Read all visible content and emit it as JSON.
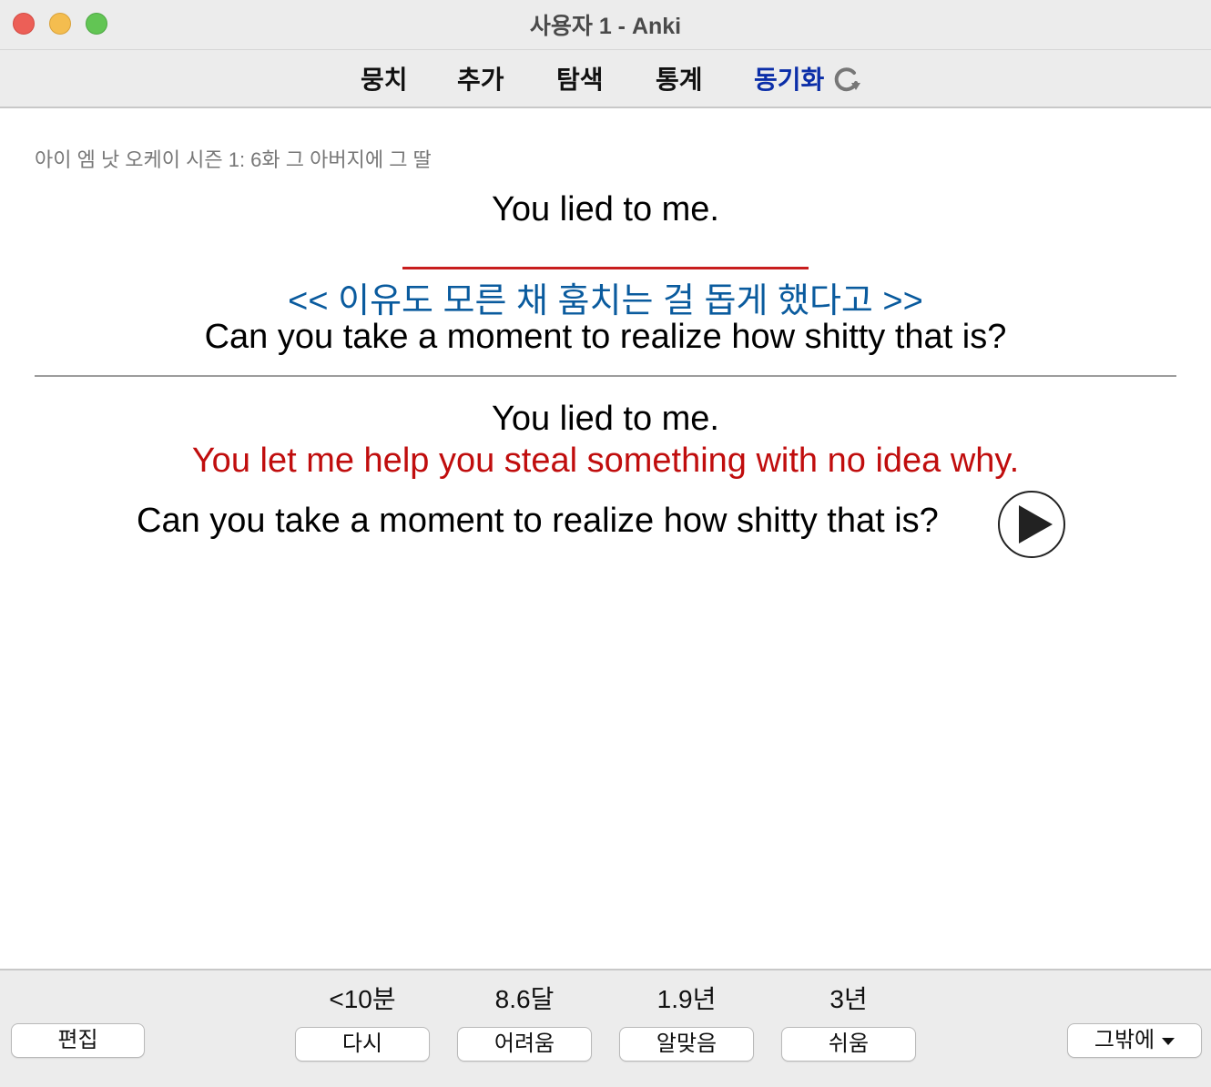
{
  "window": {
    "title": "사용자 1 - Anki"
  },
  "toolbar": {
    "decks": "뭉치",
    "add": "추가",
    "browse": "탐색",
    "stats": "통계",
    "sync": "동기화",
    "sync_icon": "refresh-icon"
  },
  "card": {
    "deck_path": "아이 엠 낫 오케이 시즌 1: 6화 그 아버지에 그 딸",
    "front": {
      "line1": "You lied to me.",
      "cloze": "<< 이유도 모른 채 훔치는 걸 돕게 했다고 >>",
      "line3": "Can you take a moment to realize how shitty that is?"
    },
    "back": {
      "line1": "You lied to me.",
      "answer": "You let me help you steal something with no idea why.",
      "line3": "Can you take a moment to realize how shitty that is?",
      "audio_icon": "play-icon"
    },
    "colors": {
      "cloze": "#0a5b9e",
      "answer": "#c00d0d",
      "underline": "#c81d1d"
    }
  },
  "bottom": {
    "edit": "편집",
    "intervals": [
      "<10분",
      "8.6달",
      "1.9년",
      "3년"
    ],
    "answers": [
      "다시",
      "어려움",
      "알맞음",
      "쉬움"
    ],
    "more": "그밖에"
  }
}
